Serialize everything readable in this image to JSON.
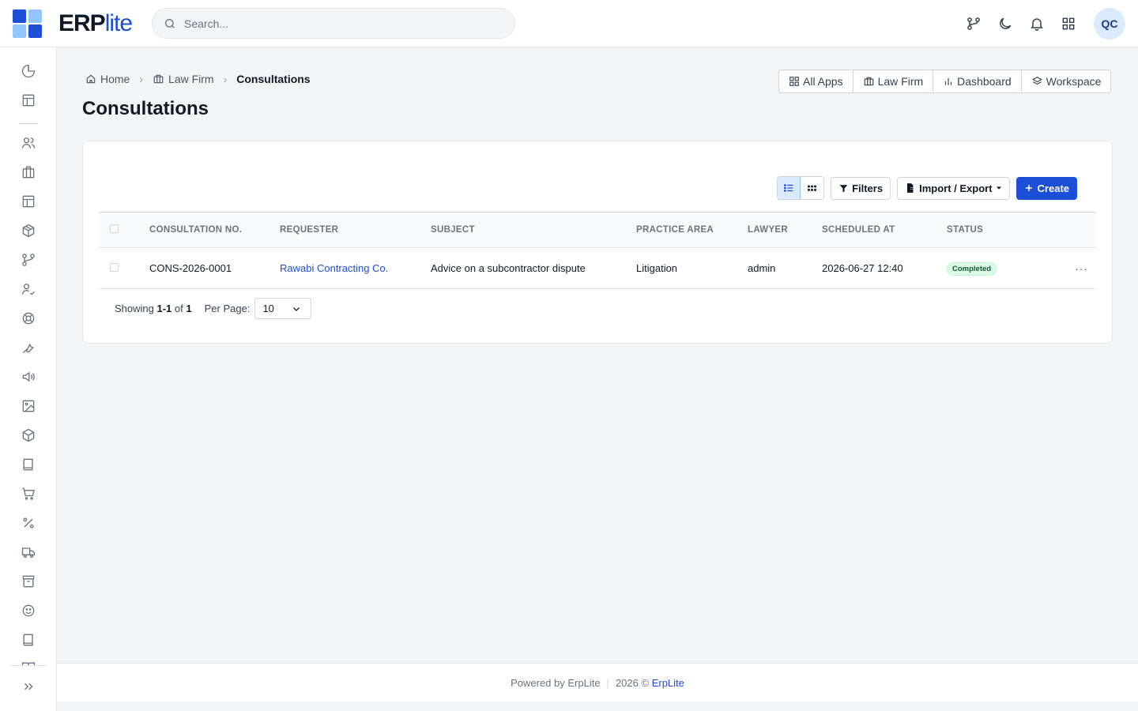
{
  "brand": {
    "name_main": "ERP",
    "name_accent": "lite",
    "primary_color": "#1d4ed8"
  },
  "search": {
    "placeholder": "Search..."
  },
  "header": {
    "avatar_initials": "QC"
  },
  "breadcrumb": [
    {
      "label": "Home",
      "icon": "home-icon"
    },
    {
      "label": "Law Firm",
      "icon": "building-icon"
    },
    {
      "label": "Consultations"
    }
  ],
  "page": {
    "title": "Consultations"
  },
  "app_nav": [
    {
      "label": "All Apps",
      "icon": "grid-icon"
    },
    {
      "label": "Law Firm",
      "icon": "building-icon"
    },
    {
      "label": "Dashboard",
      "icon": "bar-chart-icon"
    },
    {
      "label": "Workspace",
      "icon": "layers-icon"
    }
  ],
  "toolbar": {
    "filters_label": "Filters",
    "import_export_label": "Import / Export",
    "create_label": "Create"
  },
  "table": {
    "columns": [
      "CONSULTATION NO.",
      "REQUESTER",
      "SUBJECT",
      "PRACTICE AREA",
      "LAWYER",
      "SCHEDULED AT",
      "STATUS"
    ],
    "rows": [
      {
        "number": "CONS-2026-0001",
        "requester": "Rawabi Contracting Co.",
        "subject": "Advice on a subcontractor dispute",
        "practice_area": "Litigation",
        "lawyer": "admin",
        "scheduled_at": "2026-06-27 12:40",
        "status": "Completed",
        "status_color": "#dcfce7"
      }
    ]
  },
  "pagination": {
    "prefix": "Showing",
    "range": "1-1",
    "of_label": "of",
    "total": "1",
    "per_page_label": "Per Page:",
    "per_page_value": "10"
  },
  "footer": {
    "powered": "Powered by ErpLite",
    "year": "2026 ©",
    "brand": "ErpLite"
  }
}
